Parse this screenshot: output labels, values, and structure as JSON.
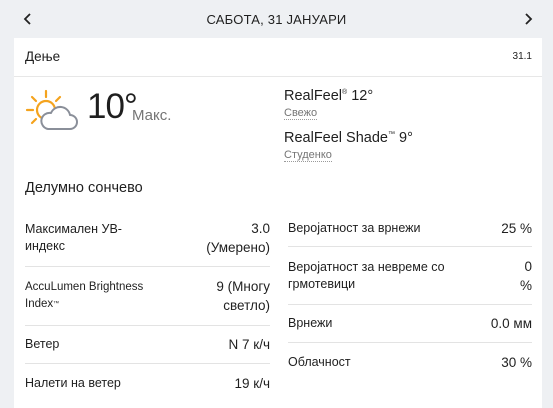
{
  "header": {
    "title": "САБОТА, 31 ЈАНУАРИ",
    "prev_icon": "chevron-left-icon",
    "next_icon": "chevron-right-icon"
  },
  "card": {
    "label": "Дење",
    "date": "31.1",
    "icon": "partly-sunny-icon",
    "temperature": "10°",
    "temp_label": "Макс.",
    "realfeel_name": "RealFeel",
    "realfeel_value": "12°",
    "realfeel_desc": "Свежо",
    "realfeel_shade_name": "RealFeel Shade",
    "realfeel_shade_value": "9°",
    "realfeel_shade_desc": "Студенко",
    "phrase": "Делумно сончево"
  },
  "left_details": [
    {
      "label": "Максимален УВ-индекс",
      "value": "3.0 (Умерено)"
    },
    {
      "label": "AccuLumen Brightness Index",
      "value": "9 (Многу светло)"
    },
    {
      "label": "Ветер",
      "value": "N 7 к/ч"
    },
    {
      "label": "Налети на ветер",
      "value": "19 к/ч"
    }
  ],
  "right_details": [
    {
      "label": "Веројатност за врнежи",
      "value": "25 %"
    },
    {
      "label": "Веројатност за невреме со грмотевици",
      "value": "0 %"
    },
    {
      "label": "Врнежи",
      "value": "0.0 мм"
    },
    {
      "label": "Облачност",
      "value": "30 %"
    }
  ],
  "colors": {
    "sun": "#f4a31e",
    "cloud_stroke": "#8a8f99",
    "page_bg": "#eef0f3",
    "card_bg": "#ffffff"
  }
}
